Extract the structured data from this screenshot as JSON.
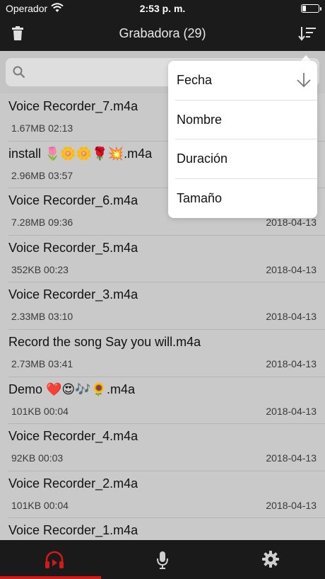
{
  "status": {
    "carrier": "Operador",
    "time": "2:53 p. m."
  },
  "nav": {
    "title": "Grabadora (29)"
  },
  "sort_menu": {
    "items": [
      {
        "label": "Fecha",
        "selected": true
      },
      {
        "label": "Nombre"
      },
      {
        "label": "Duración"
      },
      {
        "label": "Tamaño"
      }
    ]
  },
  "recordings": [
    {
      "title": "Voice Recorder_7.m4a",
      "meta": "1.67MB 02:13",
      "date": ""
    },
    {
      "title": "install 🌷🌼🌼🌹💥.m4a",
      "meta": "2.96MB 03:57",
      "date": ""
    },
    {
      "title": "Voice Recorder_6.m4a",
      "meta": "7.28MB 09:36",
      "date": "2018-04-13"
    },
    {
      "title": "Voice Recorder_5.m4a",
      "meta": "352KB 00:23",
      "date": "2018-04-13"
    },
    {
      "title": "Voice Recorder_3.m4a",
      "meta": "2.33MB 03:10",
      "date": "2018-04-13"
    },
    {
      "title": "Record the song Say you will.m4a",
      "meta": "2.73MB 03:41",
      "date": "2018-04-13"
    },
    {
      "title": "Demo ❤️😍🎶🌻.m4a",
      "meta": "101KB 00:04",
      "date": "2018-04-13"
    },
    {
      "title": "Voice Recorder_4.m4a",
      "meta": "92KB 00:03",
      "date": "2018-04-13"
    },
    {
      "title": "Voice Recorder_2.m4a",
      "meta": "101KB 00:04",
      "date": "2018-04-13"
    },
    {
      "title": "Voice Recorder_1.m4a",
      "meta": "",
      "date": ""
    }
  ],
  "colors": {
    "accent": "#d11a1a",
    "bar": "#1b1b1b",
    "list_bg": "#c9c9c9"
  },
  "icons": {
    "trash": "trash-icon",
    "sort": "sort-icon",
    "search": "search-icon",
    "recordings_tab": "headphones-play-icon",
    "record_tab": "microphone-icon",
    "settings_tab": "gear-icon"
  }
}
